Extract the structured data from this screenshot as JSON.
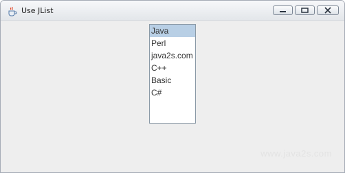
{
  "window": {
    "title": "Use JList"
  },
  "list": {
    "items": [
      "Java",
      "Perl",
      "java2s.com",
      "C++",
      "Basic",
      "C#"
    ],
    "selected_index": 0
  },
  "watermark": "www.java2s.com",
  "colors": {
    "selection": "#b8cfe5",
    "window_bg": "#eeeeee"
  }
}
